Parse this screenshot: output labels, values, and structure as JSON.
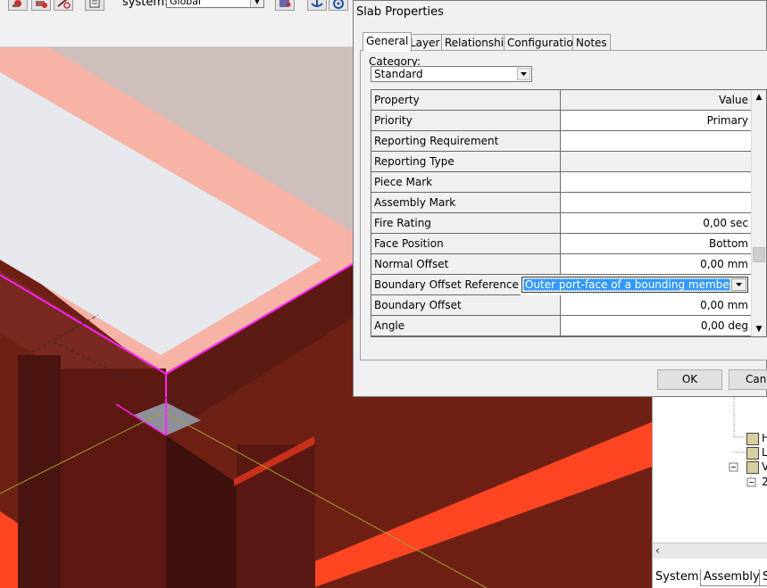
{
  "toolbar": {
    "coordinate_system_label": "system:",
    "coordinate_system_value": "Global",
    "icons": [
      "tool-icon-1",
      "tool-icon-2",
      "tool-icon-3",
      "properties-icon",
      "snap-icon",
      "anchor-icon",
      "gear-icon"
    ]
  },
  "dialog": {
    "title": "Slab Properties",
    "tabs": [
      {
        "label": "General",
        "active": true
      },
      {
        "label": "Layer",
        "active": false
      },
      {
        "label": "Relationship",
        "active": false
      },
      {
        "label": "Configuration",
        "active": false
      },
      {
        "label": "Notes",
        "active": false
      }
    ],
    "category_label": "Category:",
    "category_value": "Standard",
    "grid": {
      "header": {
        "property": "Property",
        "value": "Value"
      },
      "rows": [
        {
          "name": "Priority",
          "value": "Primary",
          "readonly": false
        },
        {
          "name": "Reporting Requirement",
          "value": "",
          "readonly": false
        },
        {
          "name": "Reporting Type",
          "value": "",
          "readonly": true
        },
        {
          "name": "Piece Mark",
          "value": "",
          "readonly": false
        },
        {
          "name": "Assembly Mark",
          "value": "",
          "readonly": false
        },
        {
          "name": "Fire Rating",
          "value": "0,00 sec",
          "readonly": false
        },
        {
          "name": "Face Position",
          "value": "Bottom",
          "readonly": false
        },
        {
          "name": "Normal Offset",
          "value": "0,00 mm",
          "readonly": false
        },
        {
          "name": "Boundary Offset Reference",
          "value": "Outer port-face of a bounding member",
          "readonly": false,
          "editing": true
        },
        {
          "name": "Boundary Offset",
          "value": "0,00 mm",
          "readonly": false
        },
        {
          "name": "Angle",
          "value": "0,00 deg",
          "readonly": false
        }
      ]
    },
    "buttons": {
      "ok": "OK",
      "cancel": "Canc"
    }
  },
  "workspace": {
    "tree_items": [
      "H",
      "L",
      "V",
      "2"
    ],
    "tabs": [
      "System",
      "Assembly",
      "S"
    ]
  },
  "colors": {
    "slab_fill": "#e6e8ee",
    "slab_edge": "#f6b3a6",
    "selection": "#ff1fff",
    "beam_dark": "#5e1812",
    "beam_mid": "#7a2418",
    "beam_bright": "#ff4020",
    "selection_blue": "#3399ff"
  }
}
